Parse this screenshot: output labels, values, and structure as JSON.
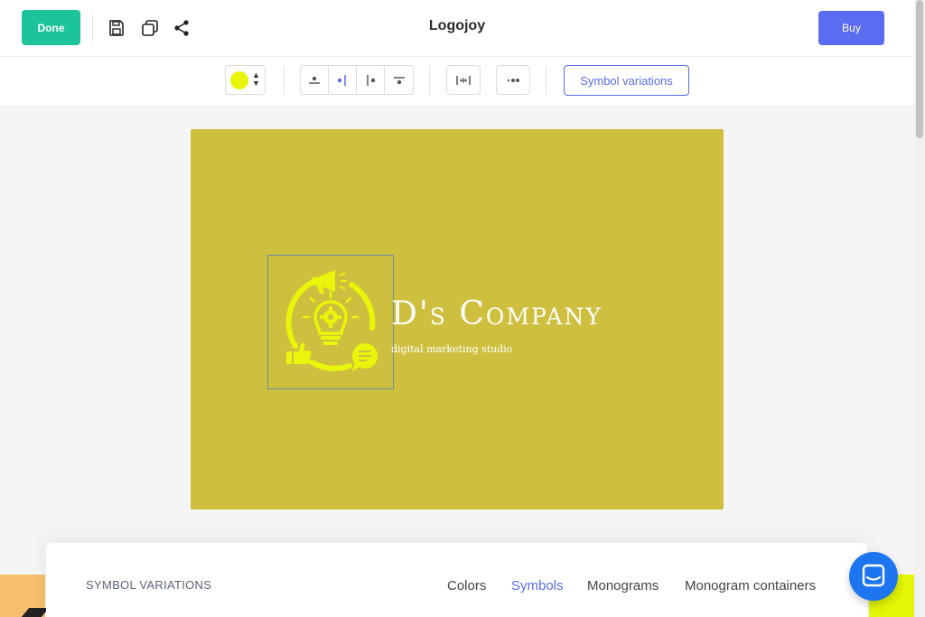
{
  "header": {
    "done_label": "Done",
    "app_title": "Logojoy",
    "buy_label": "Buy",
    "icons": [
      "save-icon",
      "duplicate-icon",
      "share-icon"
    ]
  },
  "toolbar": {
    "selected_color": "#e9f50a",
    "layout_buttons": [
      "symbol-top-icon",
      "symbol-left-icon",
      "symbol-right-icon",
      "symbol-bottom-icon"
    ],
    "spacing_buttons": [
      "spacing-icon"
    ],
    "more_button": "more-icon",
    "symbol_variations_label": "Symbol variations"
  },
  "canvas": {
    "background_color": "#cfbf3f",
    "symbol_color": "#e9f50a",
    "company_name": "D's Company",
    "tagline": "digital marketing studio"
  },
  "panel": {
    "title": "SYMBOL VARIATIONS",
    "tabs": [
      {
        "label": "Colors",
        "active": false
      },
      {
        "label": "Symbols",
        "active": true
      },
      {
        "label": "Monograms",
        "active": false
      },
      {
        "label": "Monogram containers",
        "active": false
      }
    ]
  },
  "colors": {
    "accent": "#5b6cf0",
    "done_green": "#1cc39b",
    "chat_blue": "#1d75f0"
  }
}
